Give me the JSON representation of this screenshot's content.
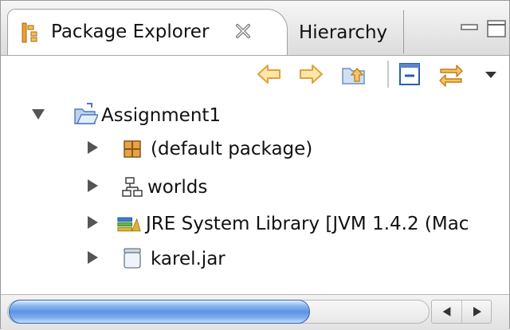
{
  "tabs": {
    "active": {
      "label": "Package Explorer",
      "icon": "package-explorer-icon"
    },
    "inactive": {
      "label": "Hierarchy"
    }
  },
  "toolbar": {
    "back_icon": "back-arrow-icon",
    "forward_icon": "forward-arrow-icon",
    "up_icon": "up-folder-icon",
    "collapse_icon": "collapse-all-icon",
    "link_icon": "link-with-editor-icon",
    "menu_icon": "view-menu-icon"
  },
  "tree": {
    "root": {
      "label": "Assignment1",
      "expanded": true,
      "icon": "project-folder-icon"
    },
    "children": [
      {
        "label": "(default package)",
        "icon": "package-icon"
      },
      {
        "label": "worlds",
        "icon": "folder-tree-icon"
      },
      {
        "label": "JRE System Library [JVM 1.4.2 (Mac",
        "icon": "library-icon"
      },
      {
        "label": "karel.jar",
        "icon": "jar-icon"
      }
    ]
  },
  "colors": {
    "accent_orange": "#f0a030",
    "scroll_blue": "#5d93e3"
  }
}
